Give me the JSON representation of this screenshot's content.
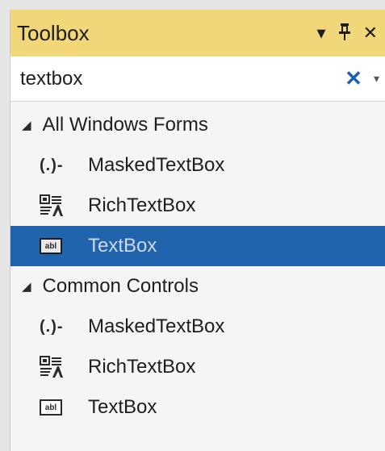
{
  "toolbox": {
    "title": "Toolbox",
    "title_icons": {
      "dropdown": "▾",
      "pin": "丨",
      "close": "✕"
    }
  },
  "search": {
    "value": "textbox",
    "clear_glyph": "✕",
    "dropdown_glyph": "▾"
  },
  "groups": [
    {
      "label": "All Windows Forms",
      "items": [
        {
          "label": "MaskedTextBox",
          "icon": "masked-textbox-icon"
        },
        {
          "label": "RichTextBox",
          "icon": "rich-textbox-icon"
        },
        {
          "label": "TextBox",
          "icon": "textbox-icon",
          "selected": true
        }
      ]
    },
    {
      "label": "Common Controls",
      "items": [
        {
          "label": "MaskedTextBox",
          "icon": "masked-textbox-icon"
        },
        {
          "label": "RichTextBox",
          "icon": "rich-textbox-icon"
        },
        {
          "label": "TextBox",
          "icon": "textbox-icon"
        }
      ]
    }
  ],
  "icon_glyphs": {
    "masked": "(.)-",
    "textbox": "abl",
    "caret": "◢"
  },
  "colors": {
    "title_bg": "#f1d67a",
    "selected_bg": "#1f64ad",
    "clear_icon": "#1a5fb4"
  }
}
